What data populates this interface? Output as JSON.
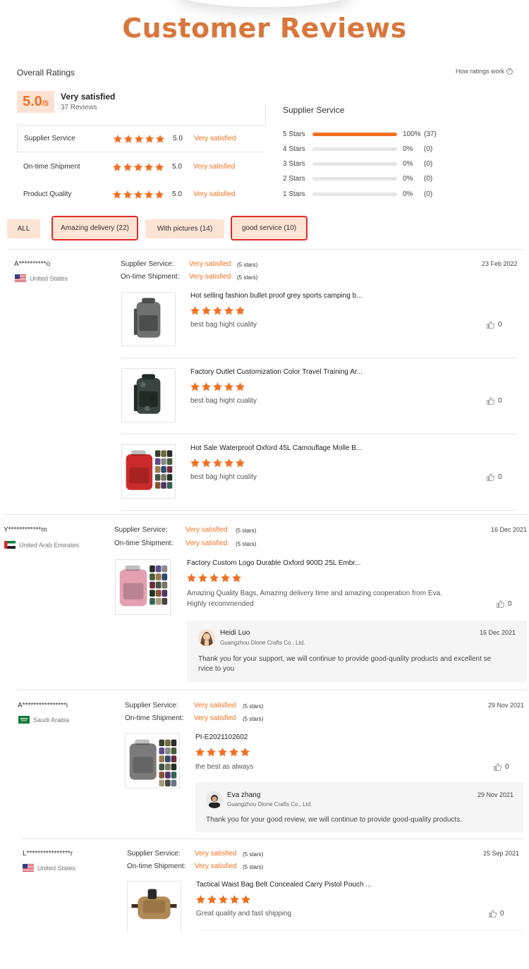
{
  "page": {
    "title": "Customer Reviews"
  },
  "colors": {
    "accent": "#f07021",
    "title": "#d8773c",
    "chip_bg": "#fde3d4",
    "highlight_border": "#e02a2a"
  },
  "overall": {
    "label": "Overall Ratings",
    "how_link": "How ratings work",
    "score": "5.0",
    "score_max": "/5",
    "satisfaction": "Very satisfied",
    "reviews_count": "37 Reviews",
    "categories": [
      {
        "name": "Supplier Service",
        "stars": 5,
        "value": "5.0",
        "satisfaction": "Very satisfied"
      },
      {
        "name": "On-time Shipment",
        "stars": 5,
        "value": "5.0",
        "satisfaction": "Very satisfied"
      },
      {
        "name": "Product Quality",
        "stars": 5,
        "value": "5.0",
        "satisfaction": "Very satisfied"
      }
    ]
  },
  "distribution": {
    "title": "Supplier Service",
    "rows": [
      {
        "label": "5 Stars",
        "fraction": 1.0,
        "percent": "100%",
        "count": "(37)"
      },
      {
        "label": "4 Stars",
        "fraction": 0,
        "percent": "0%",
        "count": "(0)"
      },
      {
        "label": "3 Stars",
        "fraction": 0,
        "percent": "0%",
        "count": "(0)"
      },
      {
        "label": "2 Stars",
        "fraction": 0,
        "percent": "0%",
        "count": "(0)"
      },
      {
        "label": "1 Stars",
        "fraction": 0,
        "percent": "0%",
        "count": "(0)"
      }
    ]
  },
  "filters": [
    {
      "label": "ALL",
      "highlighted": false
    },
    {
      "label": "Amazing delivery (22)",
      "highlighted": true
    },
    {
      "label": "With pictures (14)",
      "highlighted": false
    },
    {
      "label": "good service (10)",
      "highlighted": true
    }
  ],
  "review_labels": {
    "supplier_service": "Supplier Service:",
    "on_time_shipment": "On-time Shipment:",
    "stars_count": "(5 stars)",
    "very_satisfied": "Very satisfied"
  },
  "reviews": [
    {
      "name": "A**********o",
      "country": "United States",
      "date": "23 Feb 2022",
      "products": [
        {
          "title": "Hot selling fashion bullet proof grey sports camping b...",
          "comment": "best bag hight cuality",
          "likes": "0"
        },
        {
          "title": "Factory Outlet Customization Color Travel Training Ar...",
          "comment": "best bag hight cuality",
          "likes": "0"
        },
        {
          "title": "Hot Sale Waterproof Oxford 45L Camouflage Molle B...",
          "comment": "best bag hight cuality",
          "likes": "0"
        }
      ]
    },
    {
      "name": "Y************m",
      "country": "United Arab Emirates",
      "date": "16 Dec 2021",
      "products": [
        {
          "title": "Factory Custom Logo Durable Oxford 900D 25L Embr...",
          "comment_line1": "Amazing Quality Bags, Amazing delivery time and amazing cooperation from Eva.",
          "comment_line2": "Highly recommended",
          "likes": "0"
        }
      ],
      "reply": {
        "name": "Heidi Luo",
        "company": "Guangzhou Dione Crafts Co., Ltd.",
        "date": "16 Dec 2021",
        "text_line1": "Thank you for your support, we will continue to provide good-quality products and excellent se",
        "text_line2": "rvice to you"
      }
    },
    {
      "name": "A****************i",
      "country": "Saudi Arabia",
      "date": "29 Nov 2021",
      "products": [
        {
          "title": "PI-E2021102602",
          "comment": "the best as always",
          "likes": "0"
        }
      ],
      "reply": {
        "name": "Eva zhang",
        "company": "Guangzhou Dione Crafts Co., Ltd.",
        "date": "29 Nov 2021",
        "text_line1": "Thank you for your good review, we will continue to provide good-quality products."
      }
    },
    {
      "name": "L****************r",
      "country": "United States",
      "date": "25 Sep 2021",
      "products": [
        {
          "title": "Tactical Waist Bag Belt Concealed Carry Pistol Pouch ...",
          "comment": "Great quality and fast shipping",
          "likes": "0"
        }
      ]
    }
  ]
}
